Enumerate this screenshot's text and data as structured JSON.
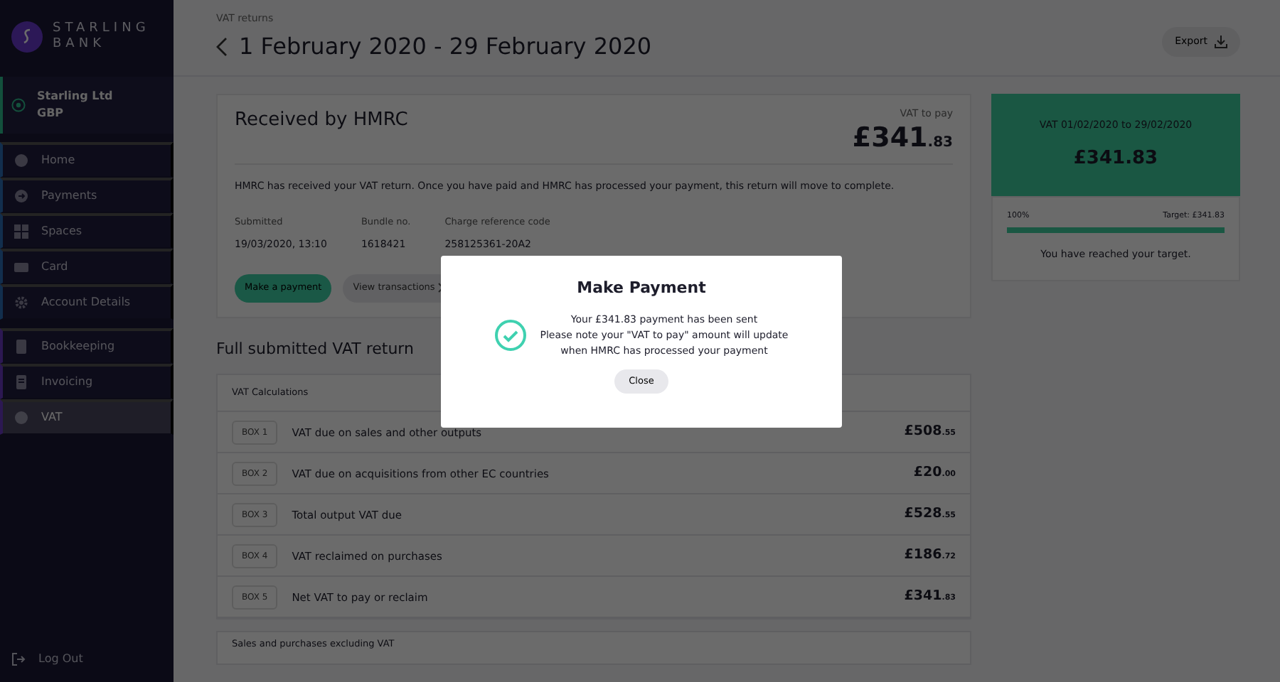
{
  "brand": {
    "name": "STARLING BANK"
  },
  "account": {
    "name": "Starling Ltd",
    "currency": "GBP"
  },
  "sidebar": {
    "items": [
      {
        "label": "Home",
        "kind": "banking",
        "selected": false
      },
      {
        "label": "Payments",
        "kind": "banking",
        "selected": false
      },
      {
        "label": "Spaces",
        "kind": "banking",
        "selected": false
      },
      {
        "label": "Card",
        "kind": "banking",
        "selected": false
      },
      {
        "label": "Account Details",
        "kind": "banking",
        "selected": false
      },
      {
        "label": "Bookkeeping",
        "kind": "business",
        "selected": false
      },
      {
        "label": "Invoicing",
        "kind": "business",
        "selected": false
      },
      {
        "label": "VAT",
        "kind": "business",
        "selected": true
      }
    ],
    "logout": "Log Out"
  },
  "header": {
    "breadcrumb": "VAT returns",
    "title": "1 February 2020 - 29 February 2020",
    "export_button": "Export"
  },
  "return_card": {
    "status": "Received by HMRC",
    "amount_label": "VAT to pay",
    "amount": "£341",
    "pence": ".83",
    "message": "HMRC has received your VAT return. Once you have paid and HMRC has processed your payment, this return will move to complete.",
    "details": [
      {
        "label": "Submitted",
        "value": "19/03/2020, 13:10"
      },
      {
        "label": "Bundle no.",
        "value": "1618421"
      },
      {
        "label": "Charge reference code",
        "value": "258125361-20A2"
      }
    ],
    "buttons": [
      {
        "label": "Make a payment",
        "kind": "primary"
      },
      {
        "label": "View transactions",
        "kind": "secondary"
      }
    ]
  },
  "full_return": {
    "title": "Full submitted VAT return",
    "panel_title": "VAT Calculations",
    "rows": [
      {
        "box": "BOX 1",
        "description": "VAT due on sales and other outputs",
        "amount": "£508",
        "pence": ".55"
      },
      {
        "box": "BOX 2",
        "description": "VAT due on acquisitions from other EC countries",
        "amount": "£20",
        "pence": ".00"
      },
      {
        "box": "BOX 3",
        "description": "Total output VAT due",
        "amount": "£528",
        "pence": ".55"
      },
      {
        "box": "BOX 4",
        "description": "VAT reclaimed on purchases",
        "amount": "£186",
        "pence": ".72"
      },
      {
        "box": "BOX 5",
        "description": "Net VAT to pay or reclaim",
        "amount": "£341",
        "pence": ".83"
      }
    ],
    "next_panel_title": "Sales and purchases excluding VAT"
  },
  "target_card": {
    "period": "VAT 01/02/2020 to 29/02/2020",
    "amount": "£341.83",
    "percent": "100%",
    "target": "Target: £341.83",
    "level": 1,
    "message": "You have reached your target."
  },
  "modal": {
    "title": "Make Payment",
    "lines": [
      "Your £341.83 payment has been sent",
      "Please note your \"VAT to pay\" amount will update",
      "when HMRC has processed your payment"
    ],
    "close_button": "Close"
  }
}
